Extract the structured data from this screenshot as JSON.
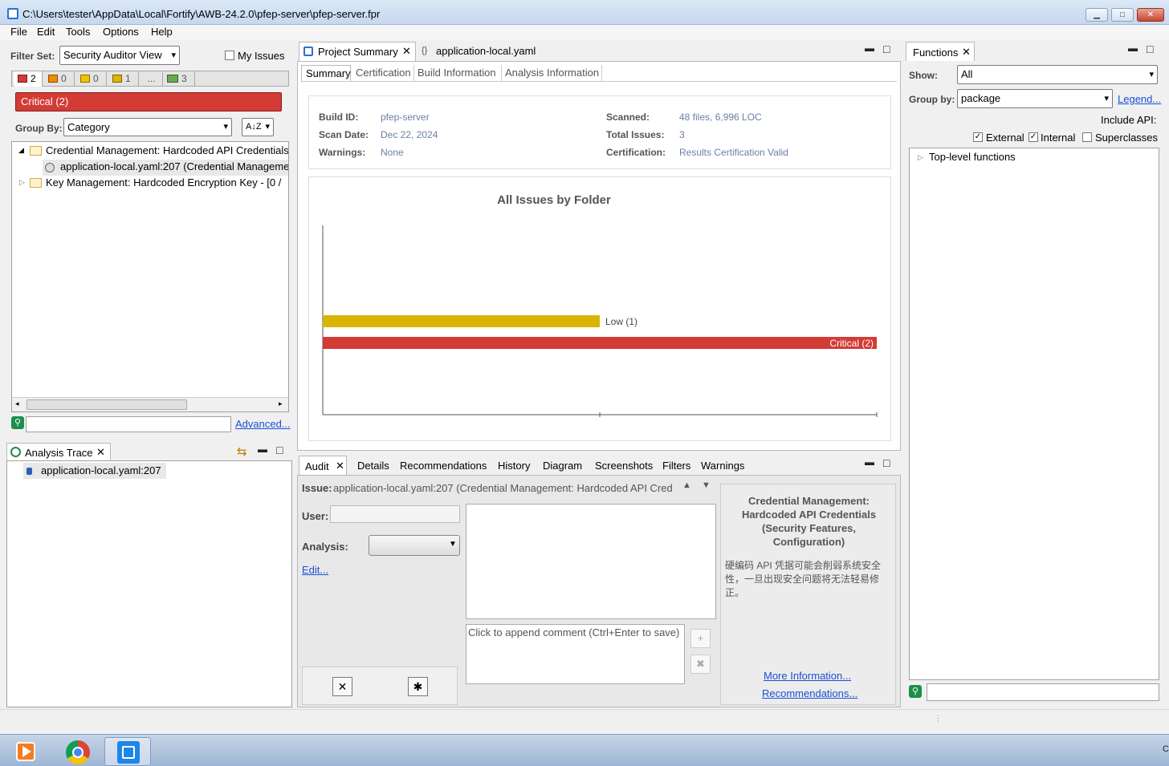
{
  "window": {
    "title": "C:\\Users\\tester\\AppData\\Local\\Fortify\\AWB-24.2.0\\pfep-server\\pfep-server.fpr",
    "buttons": {
      "minimize": "▁",
      "maximize": "□",
      "close": "✕"
    }
  },
  "menu": [
    "File",
    "Edit",
    "Tools",
    "Options",
    "Help"
  ],
  "filter": {
    "label": "Filter Set:",
    "value": "Security Auditor View",
    "my_issues": "My Issues",
    "counts": [
      "2",
      "0",
      "0",
      "1",
      "...",
      "3"
    ],
    "colors": [
      "#d33b35",
      "#f08a00",
      "#f2c200",
      "#e1b400",
      "#999999",
      "#6aa84f"
    ],
    "critical_label": "Critical (2)",
    "group_by_label": "Group By:",
    "group_by_value": "Category",
    "sort_icon": "A↓Z"
  },
  "tree": {
    "items": [
      {
        "label": "Credential Management: Hardcoded API Credentials"
      },
      {
        "label": "application-local.yaml:207 (Credential Manageme"
      },
      {
        "label": "Key Management: Hardcoded Encryption Key - [0 /"
      }
    ]
  },
  "search": {
    "advanced": "Advanced..."
  },
  "analysis_trace": {
    "title": "Analysis Trace",
    "item": "application-local.yaml:207"
  },
  "editor_tabs": {
    "project_summary": "Project Summary",
    "yaml": "application-local.yaml"
  },
  "summary_tabs": [
    "Summary",
    "Certification",
    "Build Information",
    "Analysis Information"
  ],
  "summary": {
    "build_id_label": "Build ID:",
    "build_id": "pfep-server",
    "scan_date_label": "Scan Date:",
    "scan_date": "Dec 22, 2024",
    "warnings_label": "Warnings:",
    "warnings": "None",
    "scanned_label": "Scanned:",
    "scanned": "48 files, 6,996 LOC",
    "total_issues_label": "Total Issues:",
    "total_issues": "3",
    "certification_label": "Certification:",
    "certification": "Results Certification Valid"
  },
  "chart_data": {
    "type": "bar",
    "orientation": "horizontal",
    "title": "All Issues by Folder",
    "categories": [
      "Low (1)",
      "Critical (2)"
    ],
    "values": [
      1,
      2
    ],
    "colors": [
      "#d9b400",
      "#d33b35"
    ],
    "xlim": [
      0,
      2
    ]
  },
  "audit": {
    "tabs": [
      "Audit",
      "Details",
      "Recommendations",
      "History",
      "Diagram",
      "Screenshots",
      "Filters",
      "Warnings"
    ],
    "issue_label": "Issue:",
    "issue_value": "application-local.yaml:207 (Credential Management: Hardcoded API Cred",
    "user_label": "User:",
    "analysis_label": "Analysis:",
    "edit_link": "Edit...",
    "comment_placeholder": "Click to append comment (Ctrl+Enter to save)",
    "desc_title": "Credential Management: Hardcoded API Credentials (Security Features, Configuration)",
    "desc_text": "硬编码 API 凭据可能会削弱系统安全性，一旦出现安全问题将无法轻易修正。",
    "more_info": "More Information...",
    "recommendations": "Recommendations..."
  },
  "functions": {
    "title": "Functions",
    "show_label": "Show:",
    "show_value": "All",
    "group_label": "Group by:",
    "group_value": "package",
    "legend": "Legend...",
    "include_api": "Include API:",
    "external": "External",
    "internal": "Internal",
    "superclasses": "Superclasses",
    "tree_item": "Top-level functions"
  },
  "taskbar": {
    "tray_text": "C"
  }
}
